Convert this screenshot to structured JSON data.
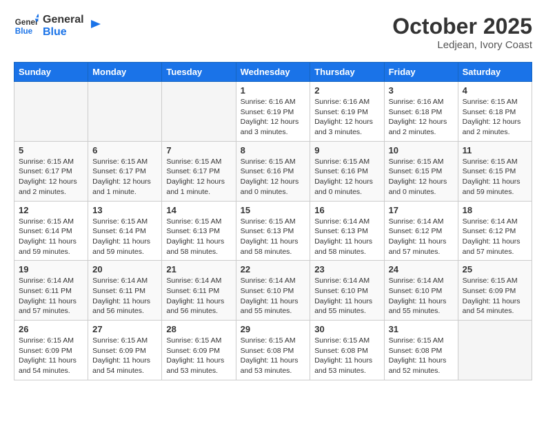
{
  "logo": {
    "line1": "General",
    "line2": "Blue"
  },
  "title": "October 2025",
  "location": "Ledjean, Ivory Coast",
  "weekdays": [
    "Sunday",
    "Monday",
    "Tuesday",
    "Wednesday",
    "Thursday",
    "Friday",
    "Saturday"
  ],
  "weeks": [
    [
      {
        "day": "",
        "info": ""
      },
      {
        "day": "",
        "info": ""
      },
      {
        "day": "",
        "info": ""
      },
      {
        "day": "1",
        "info": "Sunrise: 6:16 AM\nSunset: 6:19 PM\nDaylight: 12 hours\nand 3 minutes."
      },
      {
        "day": "2",
        "info": "Sunrise: 6:16 AM\nSunset: 6:19 PM\nDaylight: 12 hours\nand 3 minutes."
      },
      {
        "day": "3",
        "info": "Sunrise: 6:16 AM\nSunset: 6:18 PM\nDaylight: 12 hours\nand 2 minutes."
      },
      {
        "day": "4",
        "info": "Sunrise: 6:15 AM\nSunset: 6:18 PM\nDaylight: 12 hours\nand 2 minutes."
      }
    ],
    [
      {
        "day": "5",
        "info": "Sunrise: 6:15 AM\nSunset: 6:17 PM\nDaylight: 12 hours\nand 2 minutes."
      },
      {
        "day": "6",
        "info": "Sunrise: 6:15 AM\nSunset: 6:17 PM\nDaylight: 12 hours\nand 1 minute."
      },
      {
        "day": "7",
        "info": "Sunrise: 6:15 AM\nSunset: 6:17 PM\nDaylight: 12 hours\nand 1 minute."
      },
      {
        "day": "8",
        "info": "Sunrise: 6:15 AM\nSunset: 6:16 PM\nDaylight: 12 hours\nand 0 minutes."
      },
      {
        "day": "9",
        "info": "Sunrise: 6:15 AM\nSunset: 6:16 PM\nDaylight: 12 hours\nand 0 minutes."
      },
      {
        "day": "10",
        "info": "Sunrise: 6:15 AM\nSunset: 6:15 PM\nDaylight: 12 hours\nand 0 minutes."
      },
      {
        "day": "11",
        "info": "Sunrise: 6:15 AM\nSunset: 6:15 PM\nDaylight: 11 hours\nand 59 minutes."
      }
    ],
    [
      {
        "day": "12",
        "info": "Sunrise: 6:15 AM\nSunset: 6:14 PM\nDaylight: 11 hours\nand 59 minutes."
      },
      {
        "day": "13",
        "info": "Sunrise: 6:15 AM\nSunset: 6:14 PM\nDaylight: 11 hours\nand 59 minutes."
      },
      {
        "day": "14",
        "info": "Sunrise: 6:15 AM\nSunset: 6:13 PM\nDaylight: 11 hours\nand 58 minutes."
      },
      {
        "day": "15",
        "info": "Sunrise: 6:15 AM\nSunset: 6:13 PM\nDaylight: 11 hours\nand 58 minutes."
      },
      {
        "day": "16",
        "info": "Sunrise: 6:14 AM\nSunset: 6:13 PM\nDaylight: 11 hours\nand 58 minutes."
      },
      {
        "day": "17",
        "info": "Sunrise: 6:14 AM\nSunset: 6:12 PM\nDaylight: 11 hours\nand 57 minutes."
      },
      {
        "day": "18",
        "info": "Sunrise: 6:14 AM\nSunset: 6:12 PM\nDaylight: 11 hours\nand 57 minutes."
      }
    ],
    [
      {
        "day": "19",
        "info": "Sunrise: 6:14 AM\nSunset: 6:11 PM\nDaylight: 11 hours\nand 57 minutes."
      },
      {
        "day": "20",
        "info": "Sunrise: 6:14 AM\nSunset: 6:11 PM\nDaylight: 11 hours\nand 56 minutes."
      },
      {
        "day": "21",
        "info": "Sunrise: 6:14 AM\nSunset: 6:11 PM\nDaylight: 11 hours\nand 56 minutes."
      },
      {
        "day": "22",
        "info": "Sunrise: 6:14 AM\nSunset: 6:10 PM\nDaylight: 11 hours\nand 55 minutes."
      },
      {
        "day": "23",
        "info": "Sunrise: 6:14 AM\nSunset: 6:10 PM\nDaylight: 11 hours\nand 55 minutes."
      },
      {
        "day": "24",
        "info": "Sunrise: 6:14 AM\nSunset: 6:10 PM\nDaylight: 11 hours\nand 55 minutes."
      },
      {
        "day": "25",
        "info": "Sunrise: 6:15 AM\nSunset: 6:09 PM\nDaylight: 11 hours\nand 54 minutes."
      }
    ],
    [
      {
        "day": "26",
        "info": "Sunrise: 6:15 AM\nSunset: 6:09 PM\nDaylight: 11 hours\nand 54 minutes."
      },
      {
        "day": "27",
        "info": "Sunrise: 6:15 AM\nSunset: 6:09 PM\nDaylight: 11 hours\nand 54 minutes."
      },
      {
        "day": "28",
        "info": "Sunrise: 6:15 AM\nSunset: 6:09 PM\nDaylight: 11 hours\nand 53 minutes."
      },
      {
        "day": "29",
        "info": "Sunrise: 6:15 AM\nSunset: 6:08 PM\nDaylight: 11 hours\nand 53 minutes."
      },
      {
        "day": "30",
        "info": "Sunrise: 6:15 AM\nSunset: 6:08 PM\nDaylight: 11 hours\nand 53 minutes."
      },
      {
        "day": "31",
        "info": "Sunrise: 6:15 AM\nSunset: 6:08 PM\nDaylight: 11 hours\nand 52 minutes."
      },
      {
        "day": "",
        "info": ""
      }
    ]
  ]
}
